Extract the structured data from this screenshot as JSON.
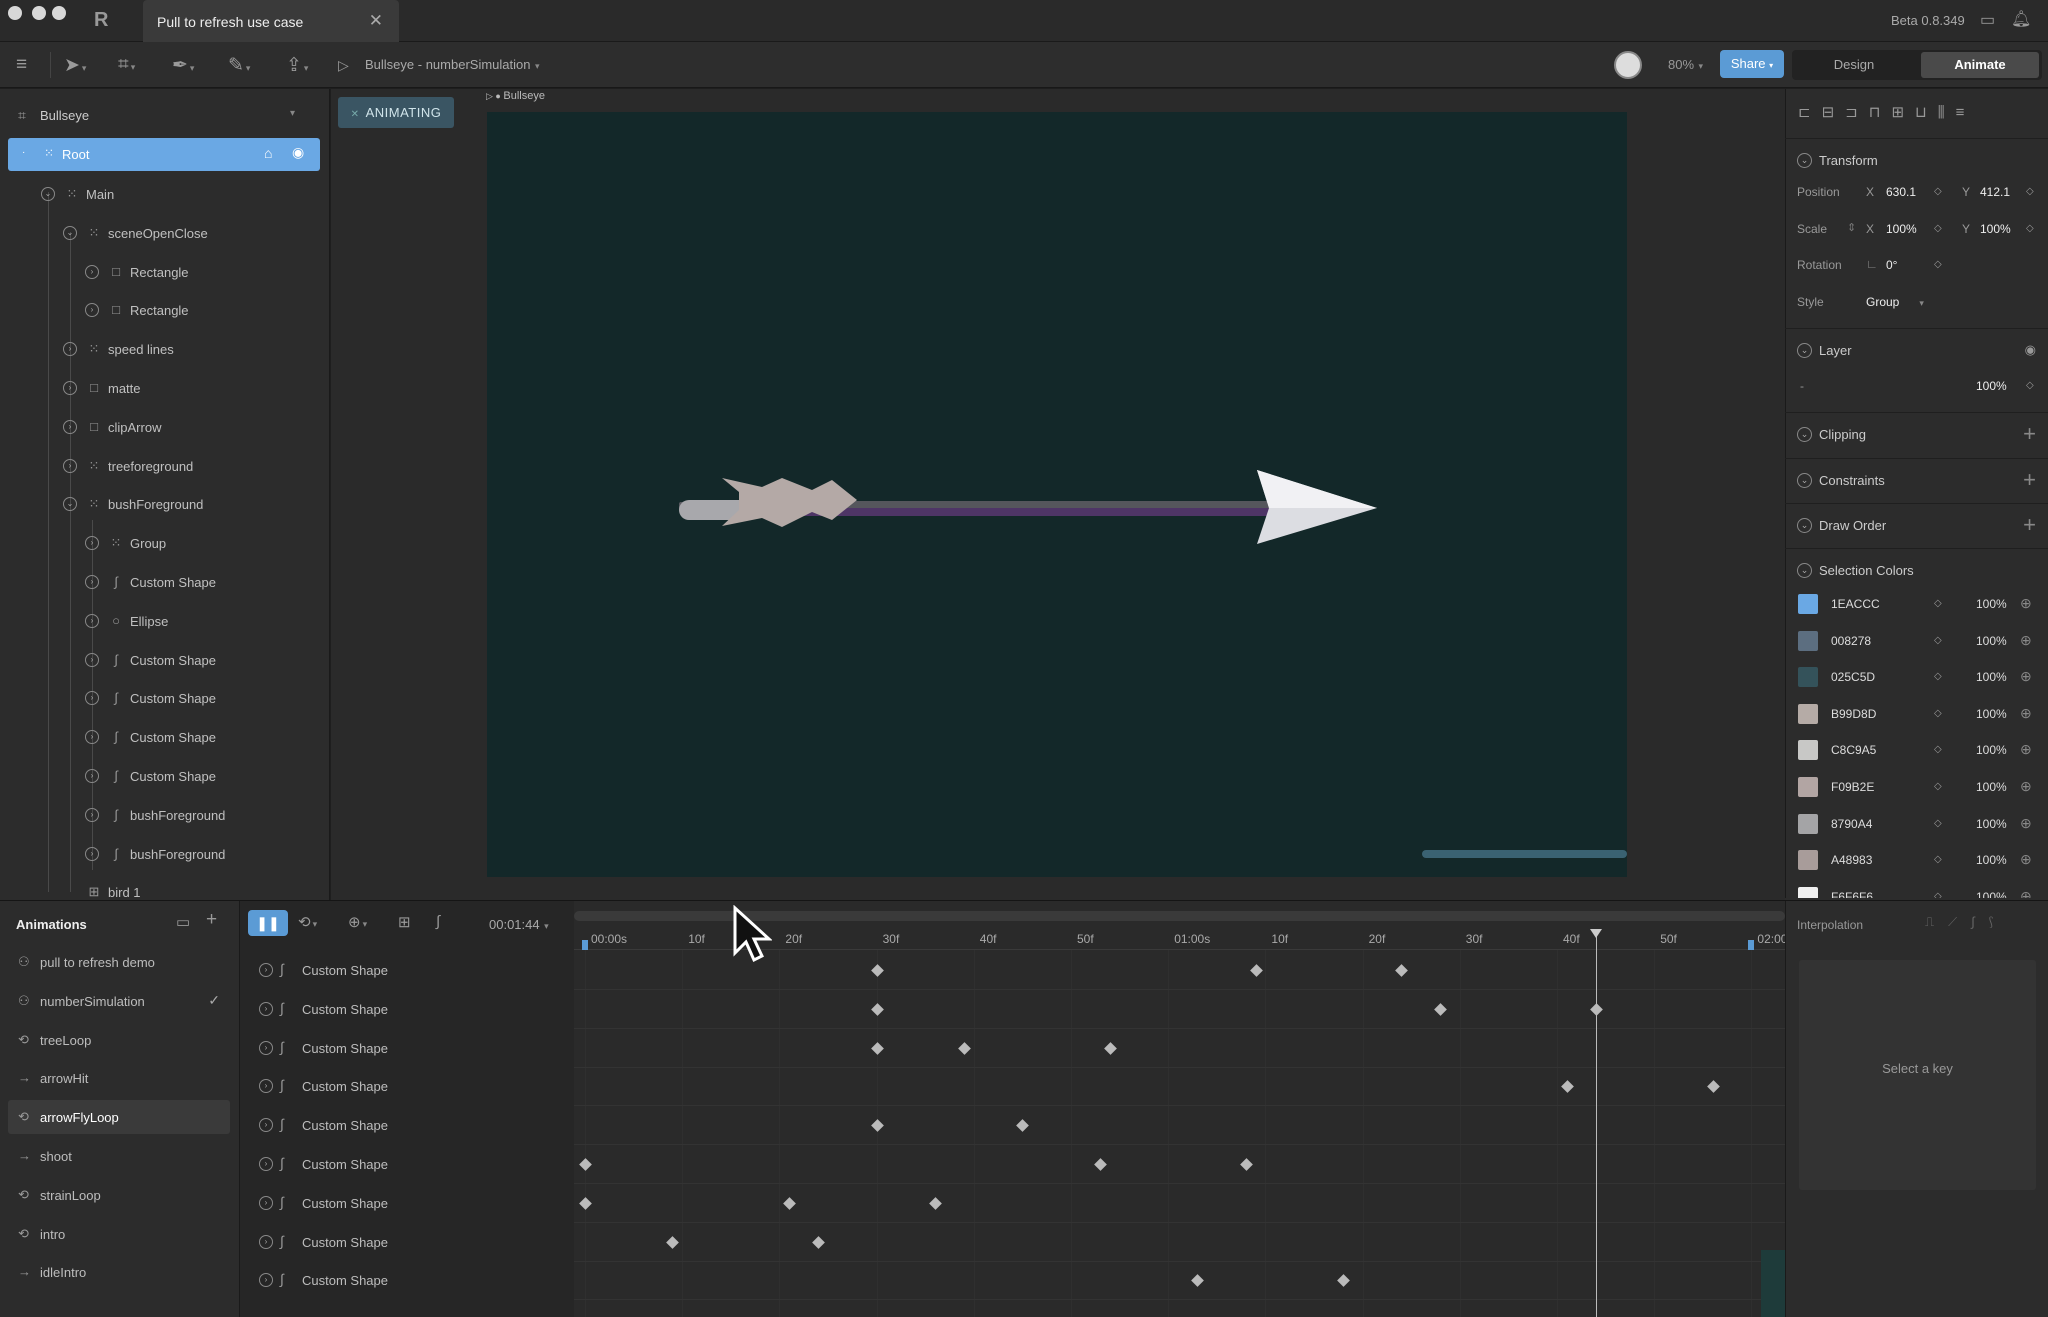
{
  "window": {
    "tab_title": "Pull to refresh use case",
    "tab_close": "✕",
    "version": "Beta 0.8.349"
  },
  "toolbar": {
    "breadcrumb": "Bullseye - numberSimulation",
    "zoom": "80%",
    "share": "Share",
    "mode_design": "Design",
    "mode_animate": "Animate"
  },
  "hierarchy": {
    "artboard": "Bullseye",
    "root": "Root",
    "items": [
      {
        "label": "Main"
      },
      {
        "label": "sceneOpenClose"
      },
      {
        "label": "Rectangle"
      },
      {
        "label": "Rectangle"
      },
      {
        "label": "speed lines"
      },
      {
        "label": "matte"
      },
      {
        "label": "clipArrow"
      },
      {
        "label": "treeforeground"
      },
      {
        "label": "bushForeground"
      },
      {
        "label": "Group"
      },
      {
        "label": "Custom Shape"
      },
      {
        "label": "Ellipse"
      },
      {
        "label": "Custom Shape"
      },
      {
        "label": "Custom Shape"
      },
      {
        "label": "Custom Shape"
      },
      {
        "label": "Custom Shape"
      },
      {
        "label": "bushForeground"
      },
      {
        "label": "bushForeground"
      },
      {
        "label": "bird 1"
      }
    ]
  },
  "canvas": {
    "badge": "ANIMATING",
    "artboard_label": "Bullseye",
    "background": "#132829"
  },
  "inspector": {
    "transform": {
      "title": "Transform",
      "position_label": "Position",
      "x_label": "X",
      "x": "630.1",
      "y_label": "Y",
      "y": "412.1",
      "scale_label": "Scale",
      "scale_x": "100%",
      "scale_y": "100%",
      "rotation_label": "Rotation",
      "rotation": "0°",
      "style_label": "Style",
      "style": "Group"
    },
    "layer": {
      "title": "Layer",
      "blend": "-",
      "opacity": "100%"
    },
    "clipping": "Clipping",
    "constraints": "Constraints",
    "draw_order": "Draw Order",
    "selection_colors": {
      "title": "Selection Colors",
      "colors": [
        {
          "hex": "1EACCC",
          "swatch": "#6aa8e4",
          "pct": "100%"
        },
        {
          "hex": "008278",
          "swatch": "#5c6e80",
          "pct": "100%"
        },
        {
          "hex": "025C5D",
          "swatch": "#34525a",
          "pct": "100%"
        },
        {
          "hex": "B99D8D",
          "swatch": "#b5aba6",
          "pct": "100%"
        },
        {
          "hex": "C8C9A5",
          "swatch": "#c8c8c6",
          "pct": "100%"
        },
        {
          "hex": "F09B2E",
          "swatch": "#b2a5a3",
          "pct": "100%"
        },
        {
          "hex": "8790A4",
          "swatch": "#a4a4a6",
          "pct": "100%"
        },
        {
          "hex": "A48983",
          "swatch": "#a89c9a",
          "pct": "100%"
        },
        {
          "hex": "F6F6F6",
          "swatch": "#f0f0f0",
          "pct": "100%"
        }
      ]
    }
  },
  "animations": {
    "title": "Animations",
    "items": [
      {
        "label": "pull to refresh demo",
        "icon": "⚇"
      },
      {
        "label": "numberSimulation",
        "icon": "⚇",
        "checked": "✓"
      },
      {
        "label": "treeLoop",
        "icon": "⟲"
      },
      {
        "label": "arrowHit",
        "icon": "→"
      },
      {
        "label": "arrowFlyLoop",
        "icon": "⟲"
      },
      {
        "label": "shoot",
        "icon": "→"
      },
      {
        "label": "strainLoop",
        "icon": "⟲"
      },
      {
        "label": "intro",
        "icon": "⟲"
      },
      {
        "label": "idleIntro",
        "icon": "→"
      }
    ]
  },
  "timeline": {
    "timecode": "00:01:44",
    "ruler": [
      "00:00s",
      "10f",
      "20f",
      "30f",
      "40f",
      "50f",
      "01:00s",
      "10f",
      "20f",
      "30f",
      "40f",
      "50f",
      "02:00"
    ],
    "tracks": [
      {
        "label": "Custom Shape",
        "keys": [
          30,
          69,
          84
        ]
      },
      {
        "label": "Custom Shape",
        "keys": [
          30,
          88,
          104
        ]
      },
      {
        "label": "Custom Shape",
        "keys": [
          30,
          39,
          54
        ]
      },
      {
        "label": "Custom Shape",
        "keys": [
          101,
          116
        ]
      },
      {
        "label": "Custom Shape",
        "keys": [
          30,
          45
        ]
      },
      {
        "label": "Custom Shape",
        "keys": [
          0,
          53,
          68
        ]
      },
      {
        "label": "Custom Shape",
        "keys": [
          0,
          21,
          36
        ]
      },
      {
        "label": "Custom Shape",
        "keys": [
          9,
          24
        ]
      },
      {
        "label": "Custom Shape",
        "keys": [
          63,
          78
        ]
      }
    ],
    "playhead_frame": 104
  },
  "interpolation": {
    "title": "Interpolation",
    "empty": "Select a key"
  }
}
